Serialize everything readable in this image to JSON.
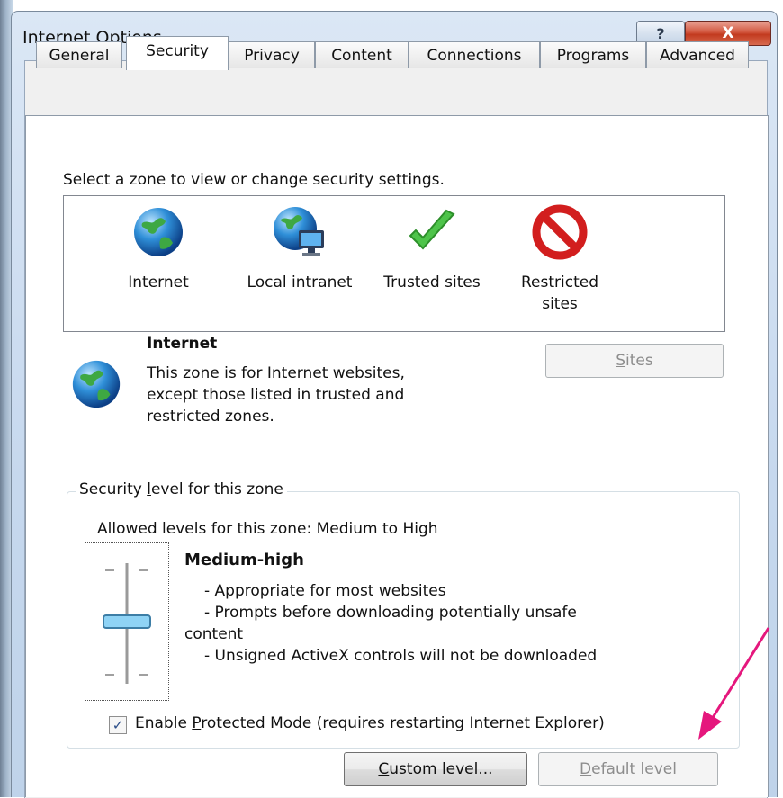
{
  "window": {
    "title": "Internet Options",
    "help_glyph": "?",
    "close_glyph": "X"
  },
  "tabs": [
    {
      "label": "General",
      "active": false
    },
    {
      "label": "Security",
      "active": true
    },
    {
      "label": "Privacy",
      "active": false
    },
    {
      "label": "Content",
      "active": false
    },
    {
      "label": "Connections",
      "active": false
    },
    {
      "label": "Programs",
      "active": false
    },
    {
      "label": "Advanced",
      "active": false
    }
  ],
  "security": {
    "select_prompt": "Select a zone to view or change security settings.",
    "zones": [
      {
        "label_line1": "Internet",
        "label_line2": "",
        "icon": "globe-icon"
      },
      {
        "label_line1": "Local intranet",
        "label_line2": "",
        "icon": "intranet-icon"
      },
      {
        "label_line1": "Trusted sites",
        "label_line2": "",
        "icon": "checkmark-icon"
      },
      {
        "label_line1": "Restricted",
        "label_line2": "sites",
        "icon": "no-entry-icon"
      }
    ],
    "selected_zone": {
      "title": "Internet",
      "description_lines": [
        "This zone is for Internet websites,",
        "except those listed in trusted and",
        "restricted zones."
      ],
      "sites_button": {
        "pre": "",
        "mnemonic": "S",
        "post": "ites",
        "enabled": false
      }
    },
    "level_group": {
      "legend_pre": "Security ",
      "legend_mnemonic": "l",
      "legend_post": "evel for this zone",
      "allowed_levels": "Allowed levels for this zone: Medium to High",
      "level_name": "Medium-high",
      "level_details": [
        "- Appropriate for most websites",
        "- Prompts before downloading potentially unsafe",
        "content",
        "- Unsigned ActiveX controls will not be downloaded"
      ],
      "slider_level_fraction": 0.5
    },
    "protected_mode": {
      "checked": true,
      "check_glyph": "✓",
      "label_pre": "Enable ",
      "label_mnemonic": "P",
      "label_post": "rotected Mode (requires restarting Internet Explorer)"
    },
    "custom_level_button": {
      "pre": "",
      "mnemonic": "C",
      "post": "ustom level...",
      "enabled": true
    },
    "default_level_button": {
      "pre": "",
      "mnemonic": "D",
      "post": "efault level",
      "enabled": false
    }
  },
  "colors": {
    "annotation_arrow": "#e5177d",
    "title_close": "#c23a1f",
    "page_background": "#ffffff"
  }
}
